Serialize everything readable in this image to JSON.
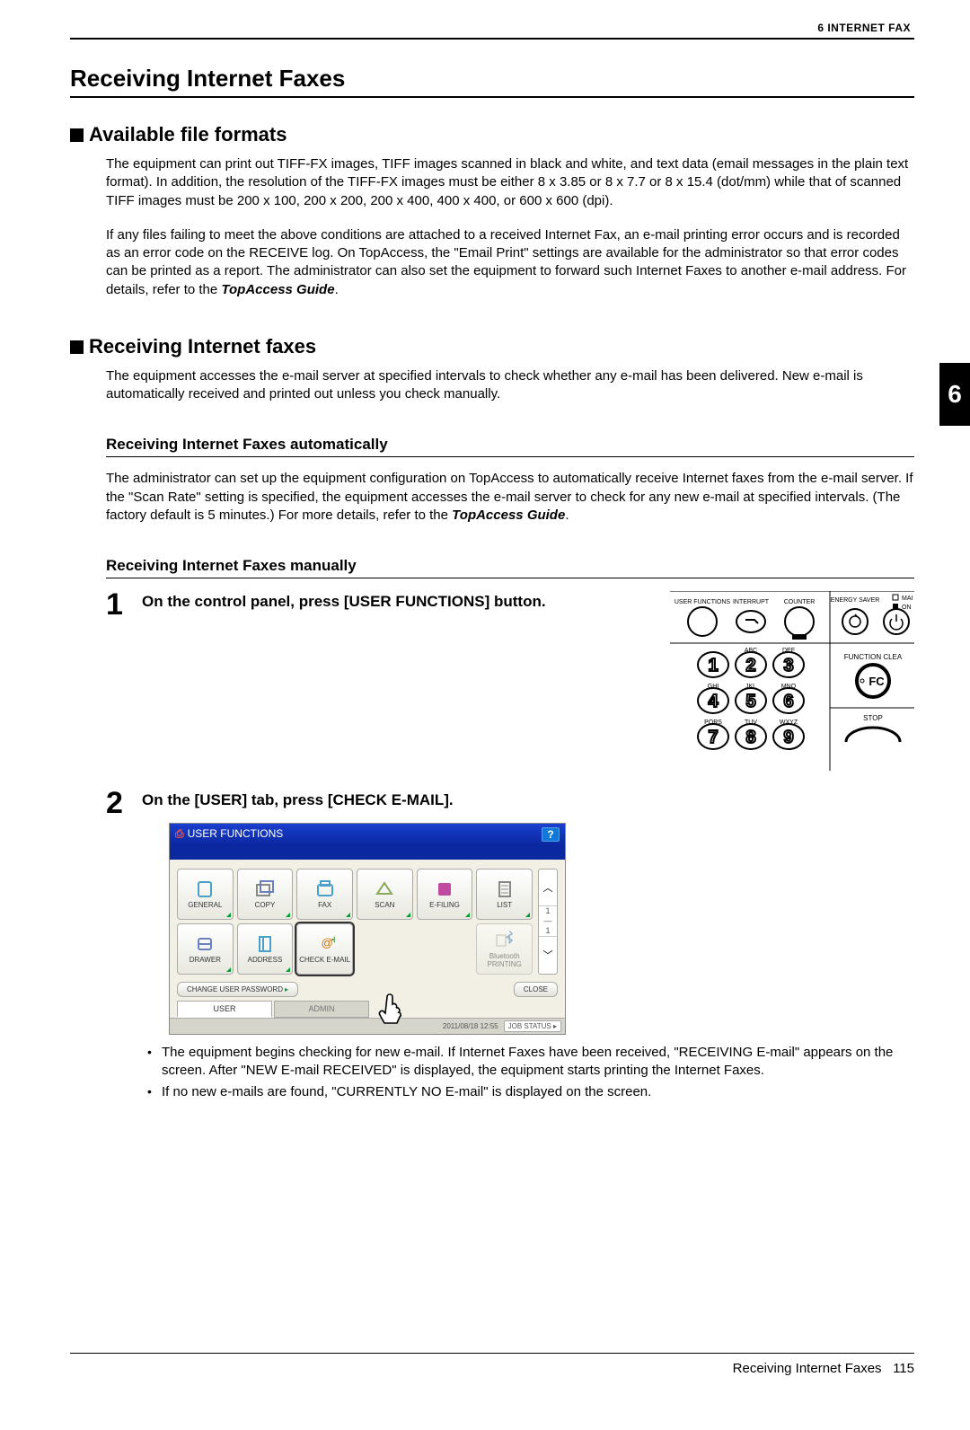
{
  "header": {
    "chapter": "6 INTERNET FAX"
  },
  "title": "Receiving Internet Faxes",
  "section1": {
    "heading": "Available file formats",
    "para1": "The equipment can print out TIFF-FX images, TIFF images scanned in black and white, and text data (email messages in the plain text format). In addition, the resolution of the TIFF-FX images must be either 8 x 3.85 or 8 x 7.7 or 8 x 15.4 (dot/mm) while that of scanned TIFF images must be 200 x 100, 200 x 200, 200 x 400, 400 x 400, or 600 x 600 (dpi).",
    "para2a": "If any files failing to meet the above conditions are attached to a received Internet Fax, an e-mail printing error occurs and is recorded as an error code on the RECEIVE log. On TopAccess, the \"Email Print\" settings are available for the administrator so that error codes can be printed as a report. The administrator can also set the equipment to forward such Internet Faxes to another e-mail address. For details, refer to the ",
    "para2b": "TopAccess Guide",
    "para2c": "."
  },
  "section2": {
    "heading": "Receiving Internet faxes",
    "intro": "The equipment accesses the e-mail server at specified intervals to check whether any e-mail has been delivered. New e-mail is automatically received and printed out unless you check manually.",
    "sub1_title": "Receiving Internet Faxes automatically",
    "sub1_a": "The administrator can set up the equipment configuration on TopAccess to automatically receive Internet faxes from the e-mail server. If the \"Scan Rate\" setting is specified, the equipment accesses the e-mail server to check for any new e-mail at specified intervals. (The factory default is 5 minutes.) For more details, refer to the ",
    "sub1_b": "TopAccess Guide",
    "sub1_c": ".",
    "sub2_title": "Receiving Internet Faxes manually",
    "step1_num": "1",
    "step1_text": "On the control panel, press [USER FUNCTIONS] button.",
    "step2_num": "2",
    "step2_text": "On the [USER] tab, press [CHECK E-MAIL].",
    "bullet1": "The equipment begins checking for new e-mail. If Internet Faxes have been received, \"RECEIVING E-mail\" appears on the screen. After \"NEW E-mail RECEIVED\" is displayed, the equipment starts printing the Internet Faxes.",
    "bullet2": "If no new e-mails are found, \"CURRENTLY NO E-mail\" is displayed on the screen."
  },
  "controlPanel": {
    "userfn": "USER FUNCTIONS",
    "interrupt": "INTERRUPT",
    "counter": "COUNTER",
    "energy": "ENERGY SAVER",
    "mai": "MAI",
    "on": "ON",
    "fc_label": "FUNCTION CLEA",
    "fc": "FC",
    "stop": "STOP",
    "keys": {
      "abc": "ABC",
      "def": "DEF",
      "ghi": "GHI",
      "jkl": "JKL",
      "mno": "MNO",
      "pqrs": "PQRS",
      "tuv": "TUV",
      "wxyz": "WXYZ"
    }
  },
  "screen": {
    "title": "USER FUNCTIONS",
    "tiles": {
      "general": "GENERAL",
      "copy": "COPY",
      "fax": "FAX",
      "scan": "SCAN",
      "efiling": "E-FILING",
      "list": "LIST",
      "drawer": "DRAWER",
      "address": "ADDRESS",
      "check": "CHECK E-MAIL",
      "bt": "Bluetooth PRINTING"
    },
    "page_top": "1",
    "page_bot": "1",
    "changepw": "CHANGE USER PASSWORD",
    "close": "CLOSE",
    "tab_user": "USER",
    "tab_admin": "ADMIN",
    "date": "2011/08/18 12:55",
    "job": "JOB STATUS"
  },
  "tab_number": "6",
  "footer": {
    "section": "Receiving Internet Faxes",
    "page": "115"
  }
}
